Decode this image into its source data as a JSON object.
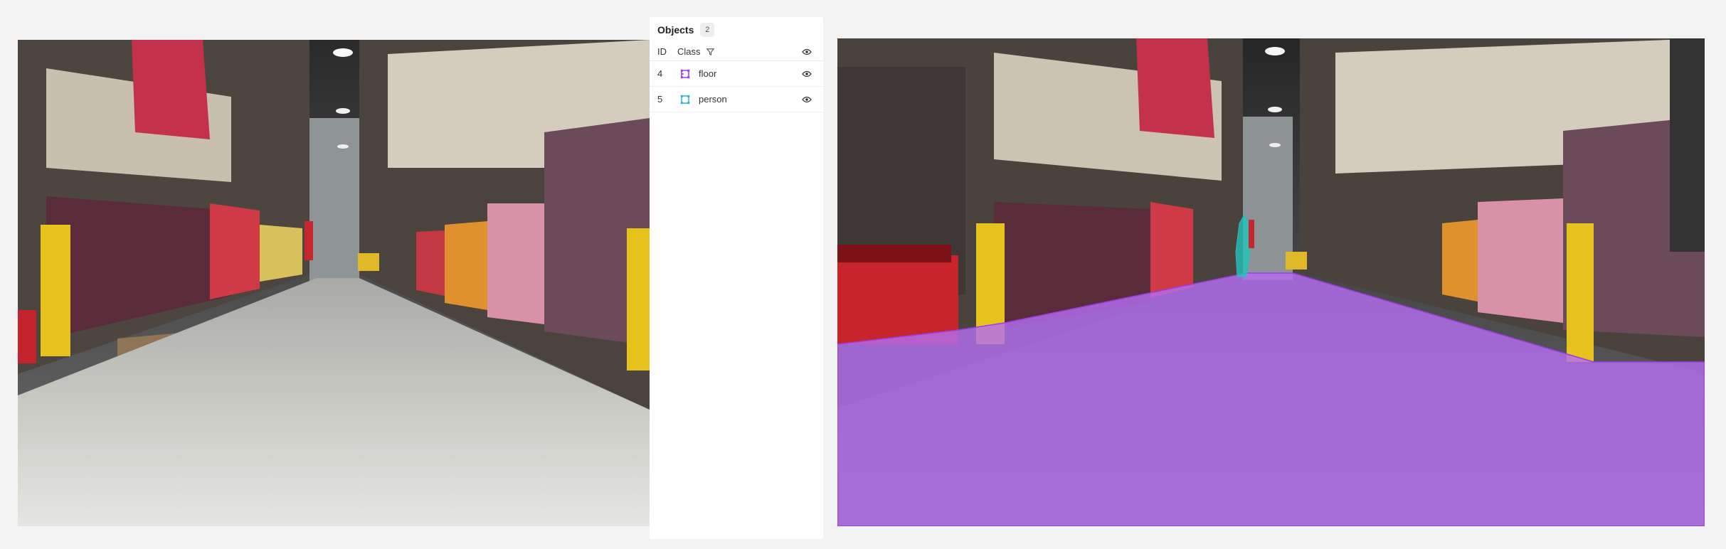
{
  "panel": {
    "title": "Objects",
    "count": "2",
    "columns": {
      "id": "ID",
      "class": "Class"
    },
    "objects": [
      {
        "id": "4",
        "class": "floor",
        "color": "#9d3ce0"
      },
      {
        "id": "5",
        "class": "person",
        "color": "#2fb6c9"
      }
    ]
  },
  "icons": {
    "filter": "filter-icon",
    "visibility": "eye-icon",
    "annotation": "polygon-icon"
  },
  "colors": {
    "floor_mask": "#b36ef0",
    "person_mask": "#22c4b8",
    "page_background": "#f3f3f3"
  }
}
